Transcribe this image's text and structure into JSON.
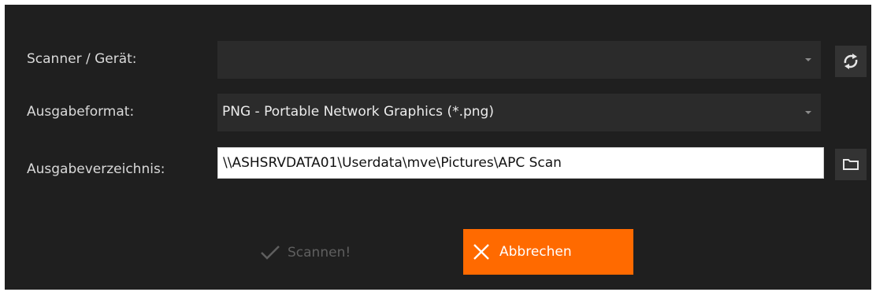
{
  "form": {
    "scanner_label": "Scanner / Gerät:",
    "scanner_value": "",
    "format_label": "Ausgabeformat:",
    "format_value": "PNG - Portable Network Graphics (*.png)",
    "dir_label": "Ausgabeverzeichnis:",
    "dir_value": "\\\\ASHSRVDATA01\\Userdata\\mve\\Pictures\\APC Scan"
  },
  "actions": {
    "scan_label": "Scannen!",
    "cancel_label": "Abbrechen"
  },
  "icons": {
    "refresh": "refresh-icon",
    "folder": "folder-icon",
    "check": "checkmark-icon",
    "close": "close-icon",
    "caret": "chevron-down-icon"
  },
  "colors": {
    "background": "#1f1f1f",
    "field": "#2b2b2b",
    "accent": "#ff6a00",
    "disabled_text": "#5f5f5f"
  }
}
